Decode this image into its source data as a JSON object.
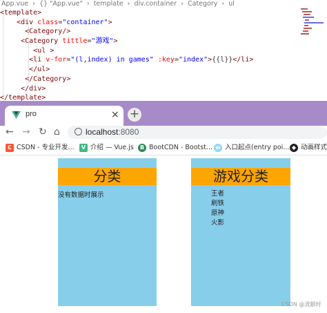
{
  "editor": {
    "breadcrumb": [
      "App.vue",
      "›",
      "{} \"App.vue\"",
      "›",
      "template",
      "›",
      "div.container",
      "›",
      "Category",
      "›",
      "ul"
    ],
    "code": {
      "l1": "<template>",
      "l2_open": "<div",
      "l2_attr": "class",
      "l2_val": "\"container\"",
      "l3": "<Category/>",
      "l4_open": "<Category",
      "l4_attr": "tittle",
      "l4_val": "\"游戏\"",
      "l5": "<ul >",
      "l6_open": "<li",
      "l6_attr1": "v-for",
      "l6_val1": "\"(l,index) in games\"",
      "l6_attr2": ":key",
      "l6_val2": "\"index\"",
      "l6_text": "{{l}}",
      "l6_close": "</li>",
      "l7": "</ul>",
      "l8": "</Category>",
      "l9": "</div>",
      "l10": "</template>"
    }
  },
  "browser": {
    "tab_title": "pro",
    "tab_close": "×",
    "new_tab": "+",
    "nav": {
      "back": "←",
      "forward": "→",
      "reload": "↻",
      "home": "⌂"
    },
    "address": {
      "host": "localhost",
      "port": ":8080"
    },
    "bookmarks": [
      {
        "label": "CSDN - 专业开发...",
        "icon": "C",
        "color": "#fc5531"
      },
      {
        "label": "介绍 — Vue.js",
        "icon": "V",
        "color": "#42b883"
      },
      {
        "label": "BootCDN - Bootst...",
        "icon": "B",
        "color": "#2e8b57"
      },
      {
        "label": "入口起点(entry poi...",
        "icon": "w",
        "color": "#8ed6fb"
      },
      {
        "label": "动画样式",
        "icon": "◆",
        "color": "#222222"
      }
    ]
  },
  "page": {
    "left_panel": {
      "title": "分类",
      "empty_message": "没有数据时展示"
    },
    "right_panel": {
      "title": "游戏分类",
      "items": [
        "王者",
        "刷铁",
        "原神",
        "火影"
      ]
    },
    "watermark": "CSDN @流额时"
  },
  "colors": {
    "panel_bg": "#87ceeb",
    "panel_title_bg": "#ffa500",
    "tabbar_bg": "#a78bc9"
  }
}
